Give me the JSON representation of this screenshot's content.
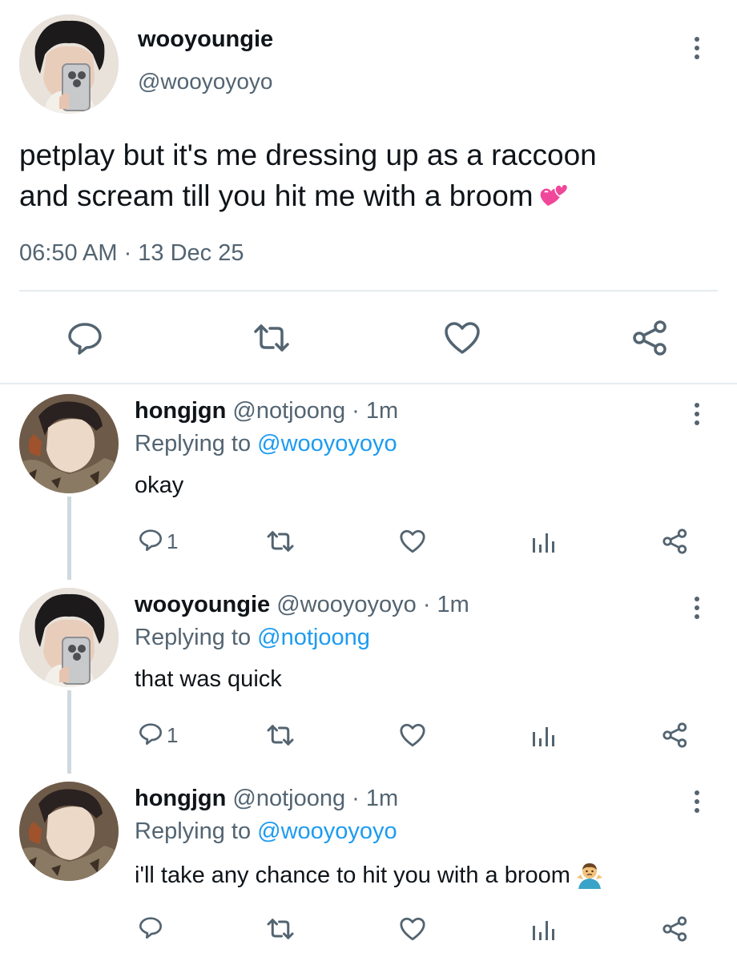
{
  "main_tweet": {
    "display_name": "wooyoungie",
    "handle": "@wooyoyoyo",
    "text_line1": "petplay but it's me dressing up as a raccoon",
    "text_line2": "and scream till you hit me with a broom",
    "emoji": "two-hearts",
    "timestamp": "06:50 AM · 13 Dec 25",
    "actions": [
      "reply",
      "retweet",
      "like",
      "share"
    ]
  },
  "replies": [
    {
      "display_name": "hongjgn",
      "meta": "@notjoong · 1m",
      "replying_prefix": "Replying to ",
      "replying_to": "@wooyoyoyo",
      "text": "okay",
      "reply_count": "1"
    },
    {
      "display_name": "wooyoungie",
      "meta": "@wooyoyoyo · 1m",
      "replying_prefix": "Replying to ",
      "replying_to": "@notjoong",
      "text": "that was quick",
      "reply_count": "1"
    },
    {
      "display_name": "hongjgn",
      "meta": "@notjoong · 1m",
      "replying_prefix": "Replying to ",
      "replying_to": "@wooyoyoyo",
      "text": "i'll take any chance to hit you with a broom",
      "emoji": "man-shrugging",
      "reply_count": ""
    }
  ],
  "colors": {
    "text": "#0f1419",
    "secondary": "#536471",
    "link": "#1d9bf0",
    "divider": "#e6ecf0"
  }
}
